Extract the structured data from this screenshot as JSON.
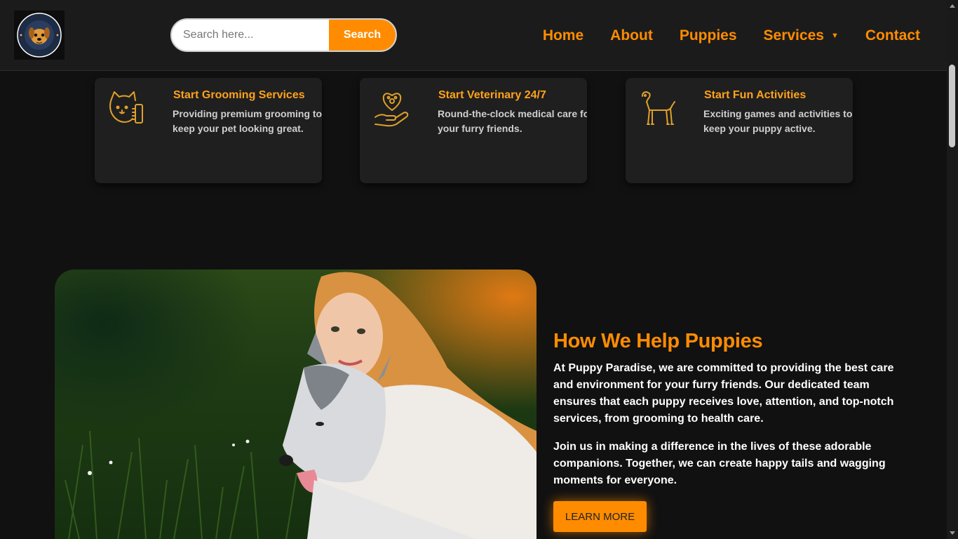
{
  "header": {
    "logo_alt": "Puppies Paradise Dogs logo",
    "logo_text_top": "PUPPIES PARADISE",
    "logo_text_bottom": "DOGS",
    "search": {
      "placeholder": "Search here...",
      "value": "",
      "button_label": "Search"
    },
    "nav": {
      "items": [
        {
          "label": "Home"
        },
        {
          "label": "About"
        },
        {
          "label": "Puppies"
        },
        {
          "label": "Services",
          "has_dropdown": true
        },
        {
          "label": "Contact"
        }
      ]
    }
  },
  "services": [
    {
      "icon": "dog-grooming-icon",
      "title": "Start Grooming Services",
      "description": "Providing premium grooming to keep your pet looking great."
    },
    {
      "icon": "paw-heart-hand-icon",
      "title": "Start Veterinary 24/7",
      "description": "Round-the-clock medical care for your furry friends."
    },
    {
      "icon": "dog-standing-icon",
      "title": "Start Fun Activities",
      "description": "Exciting games and activities to keep your puppy active."
    }
  ],
  "about": {
    "image_alt": "Woman hugging a husky dog in the grass",
    "title": "How We Help Puppies",
    "paragraph1": "At Puppy Paradise, we are committed to providing the best care and environment for your furry friends. Our dedicated team ensures that each puppy receives love, attention, and top-notch services, from grooming to health care.",
    "paragraph2": "Join us in making a difference in the lives of these adorable companions. Together, we can create happy tails and wagging moments for everyone.",
    "button_label": "LEARN MORE"
  },
  "colors": {
    "accent": "#ff8c00",
    "card_title": "#ffa21a",
    "background": "#111111",
    "header_bg": "#1b1b1b",
    "card_bg": "#1f1f1f"
  }
}
